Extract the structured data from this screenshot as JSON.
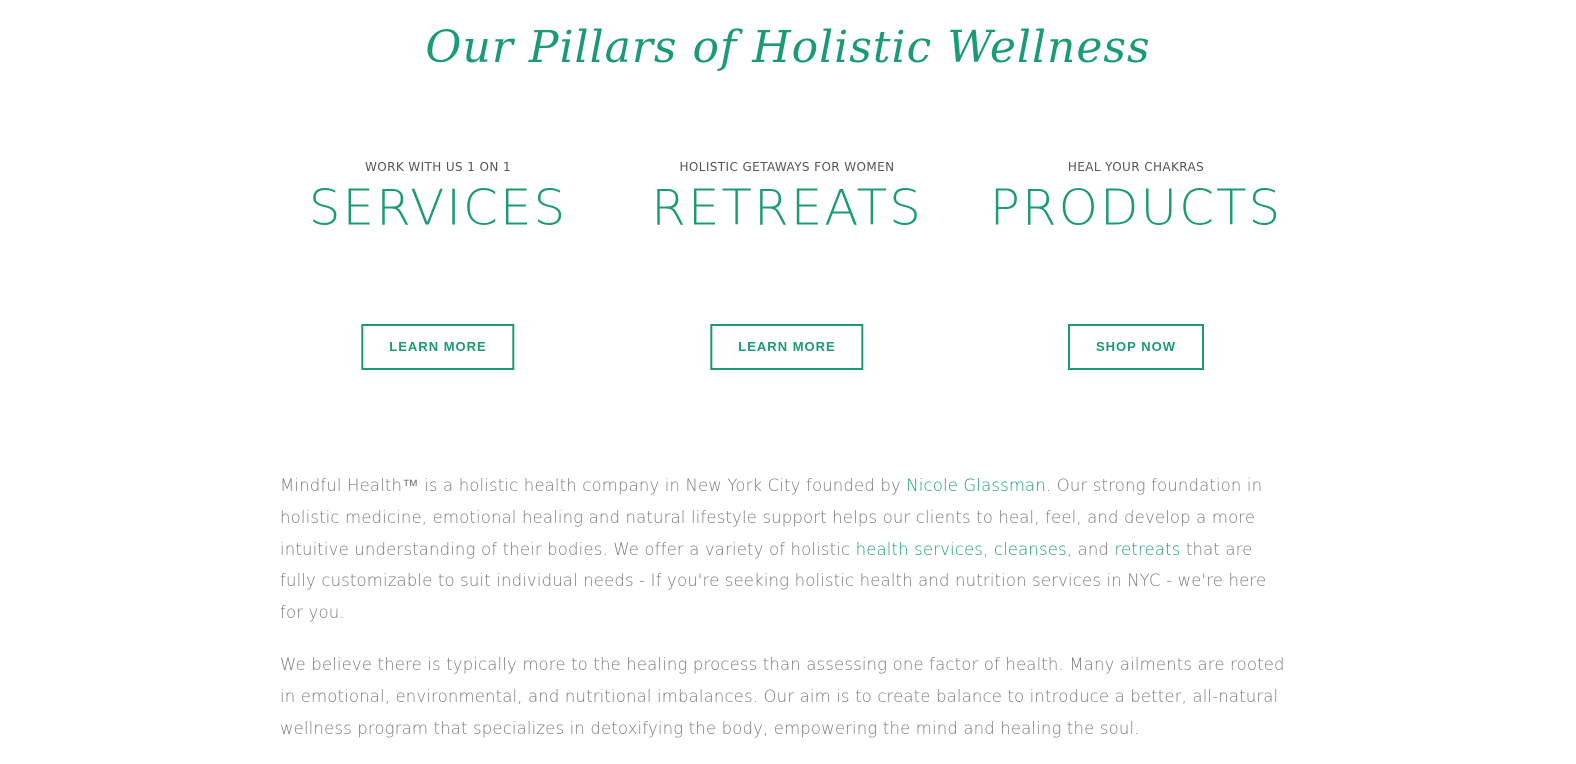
{
  "heading": "Our Pillars of Holistic Wellness",
  "pillars": [
    {
      "kicker": "WORK WITH US 1 ON 1",
      "title": "SERVICES",
      "button": "LEARN MORE"
    },
    {
      "kicker": "HOLISTIC GETAWAYS FOR WOMEN",
      "title": "RETREATS",
      "button": "LEARN MORE"
    },
    {
      "kicker": "HEAL YOUR CHAKRAS",
      "title": "PRODUCTS",
      "button": "SHOP NOW"
    }
  ],
  "about": {
    "p1": {
      "text1": "Mindful Health™ is a holistic health company in New York City founded by ",
      "link_founder": "Nicole Glassman",
      "text2": ". Our strong foundation in holistic medicine, emotional healing and natural lifestyle support helps our clients to heal, feel, and develop a more intuitive understanding of their bodies. We offer a variety of holistic ",
      "link_services": "health services",
      "sep1": ", ",
      "link_cleanses": "cleanses",
      "sep2": ", and ",
      "link_retreats": "retreats",
      "text3": " that are fully customizable to suit individual needs - If you're seeking holistic health and nutrition services in NYC - we're here for you."
    },
    "p2": "We believe there is typically more to the healing process than assessing one factor of health. Many ailments are rooted in emotional, environmental, and nutritional imbalances. Our aim is to create balance to introduce a better, all-natural wellness program that specializes in detoxifying the body, empowering the mind and healing the soul."
  },
  "colors": {
    "accent": "#1a9a77",
    "body_text": "#7a7a7a",
    "kicker_text": "#555555"
  }
}
